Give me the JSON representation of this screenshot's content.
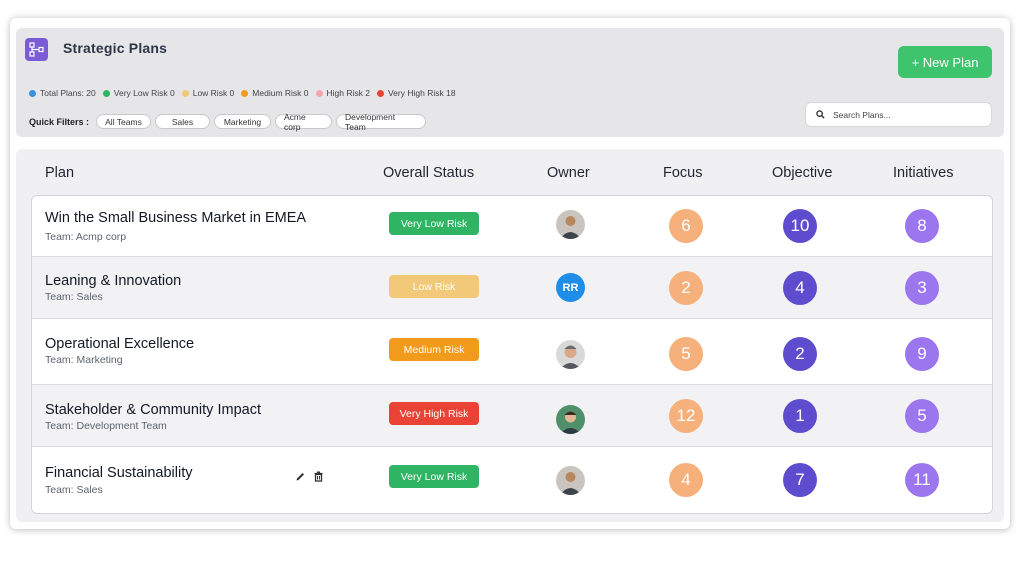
{
  "app": {
    "title": "Strategic Plans"
  },
  "stats": [
    {
      "label": "Total Plans: 20",
      "color": "#3b8fe0"
    },
    {
      "label": "Very Low Risk 0",
      "color": "#2fb463"
    },
    {
      "label": "Low Risk 0",
      "color": "#f2c879"
    },
    {
      "label": "Medium Risk 0",
      "color": "#f29a1c"
    },
    {
      "label": "High Risk 2",
      "color": "#f4a6ac"
    },
    {
      "label": "Very High Risk 18",
      "color": "#ea4335"
    }
  ],
  "quick_filters": {
    "label": "Quick Filters :",
    "chips": [
      "All Teams",
      "Sales",
      "Marketing",
      "Acme corp",
      "Development Team"
    ]
  },
  "new_plan_button": "+ New Plan",
  "search": {
    "placeholder": "Search Plans..."
  },
  "columns": {
    "plan": "Plan",
    "status": "Overall Status",
    "owner": "Owner",
    "focus": "Focus",
    "objective": "Objective",
    "initiatives": "Initiatives"
  },
  "rows": [
    {
      "name": "Win the Small Business Market in EMEA",
      "team": "Team: Acmp corp",
      "status": "Very Low Risk",
      "status_color": "#2fb463",
      "owner": "photo",
      "focus": "6",
      "objective": "10",
      "initiatives": "8"
    },
    {
      "name": "Leaning & Innovation",
      "team": "Team: Sales",
      "status": "Low Risk",
      "status_color": "#f2c879",
      "owner": "RR",
      "focus": "2",
      "objective": "4",
      "initiatives": "3"
    },
    {
      "name": "Operational Excellence",
      "team": "Team: Marketing",
      "status": "Medium Risk",
      "status_color": "#f29a1c",
      "owner": "photo",
      "focus": "5",
      "objective": "2",
      "initiatives": "9"
    },
    {
      "name": "Stakeholder & Community Impact",
      "team": "Team: Development Team",
      "status": "Very High Risk",
      "status_color": "#ea4335",
      "owner": "photo",
      "focus": "12",
      "objective": "1",
      "initiatives": "5"
    },
    {
      "name": "Financial Sustainability",
      "team": "Team: Sales",
      "status": "Very Low Risk",
      "status_color": "#2fb463",
      "owner": "photo",
      "focus": "4",
      "objective": "7",
      "initiatives": "11"
    }
  ],
  "icons": {
    "logo": "hierarchy-icon",
    "search": "search-icon",
    "edit": "pencil-icon",
    "delete": "trash-icon"
  }
}
